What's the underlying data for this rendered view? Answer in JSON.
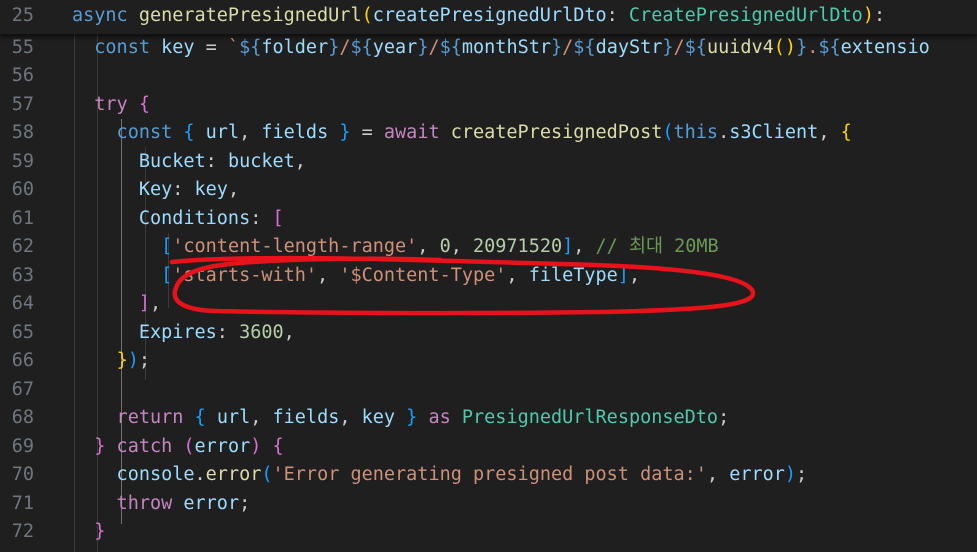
{
  "editor": {
    "sticky": {
      "line_number": "25",
      "tokens": [
        {
          "t": "async ",
          "c": "kw"
        },
        {
          "t": "generatePresignedUrl",
          "c": "fn"
        },
        {
          "t": "(",
          "c": "br1"
        },
        {
          "t": "createPresignedUrlDto",
          "c": "vr"
        },
        {
          "t": ": ",
          "c": "pn"
        },
        {
          "t": "CreatePresignedUrlDto",
          "c": "ty"
        },
        {
          "t": ")",
          "c": "br1"
        },
        {
          "t": ":",
          "c": "pn"
        }
      ]
    },
    "lines": [
      {
        "n": "55",
        "tokens": [
          {
            "t": "  const ",
            "c": "kw"
          },
          {
            "t": "key",
            "c": "vr"
          },
          {
            "t": " = ",
            "c": "pn"
          },
          {
            "t": "`",
            "c": "str"
          },
          {
            "t": "${",
            "c": "kw"
          },
          {
            "t": "folder",
            "c": "vr"
          },
          {
            "t": "}",
            "c": "kw"
          },
          {
            "t": "/",
            "c": "str"
          },
          {
            "t": "${",
            "c": "kw"
          },
          {
            "t": "year",
            "c": "vr"
          },
          {
            "t": "}",
            "c": "kw"
          },
          {
            "t": "/",
            "c": "str"
          },
          {
            "t": "${",
            "c": "kw"
          },
          {
            "t": "monthStr",
            "c": "vr"
          },
          {
            "t": "}",
            "c": "kw"
          },
          {
            "t": "/",
            "c": "str"
          },
          {
            "t": "${",
            "c": "kw"
          },
          {
            "t": "dayStr",
            "c": "vr"
          },
          {
            "t": "}",
            "c": "kw"
          },
          {
            "t": "/",
            "c": "str"
          },
          {
            "t": "${",
            "c": "kw"
          },
          {
            "t": "uuidv4",
            "c": "fn"
          },
          {
            "t": "()",
            "c": "br1"
          },
          {
            "t": "}",
            "c": "kw"
          },
          {
            "t": ".",
            "c": "str"
          },
          {
            "t": "${",
            "c": "kw"
          },
          {
            "t": "extensio",
            "c": "vr"
          }
        ]
      },
      {
        "n": "56",
        "tokens": []
      },
      {
        "n": "57",
        "tokens": [
          {
            "t": "  try ",
            "c": "ctl"
          },
          {
            "t": "{",
            "c": "br2"
          }
        ]
      },
      {
        "n": "58",
        "tokens": [
          {
            "t": "    const ",
            "c": "kw"
          },
          {
            "t": "{ ",
            "c": "br3"
          },
          {
            "t": "url",
            "c": "vr"
          },
          {
            "t": ", ",
            "c": "pn"
          },
          {
            "t": "fields",
            "c": "vr"
          },
          {
            "t": " }",
            "c": "br3"
          },
          {
            "t": " = ",
            "c": "pn"
          },
          {
            "t": "await ",
            "c": "ctl"
          },
          {
            "t": "createPresignedPost",
            "c": "fn"
          },
          {
            "t": "(",
            "c": "br3"
          },
          {
            "t": "this",
            "c": "kw"
          },
          {
            "t": ".",
            "c": "pn"
          },
          {
            "t": "s3Client",
            "c": "vr"
          },
          {
            "t": ", ",
            "c": "pn"
          },
          {
            "t": "{",
            "c": "br1"
          }
        ]
      },
      {
        "n": "59",
        "tokens": [
          {
            "t": "      Bucket",
            "c": "vr"
          },
          {
            "t": ": ",
            "c": "pn"
          },
          {
            "t": "bucket",
            "c": "vr"
          },
          {
            "t": ",",
            "c": "pn"
          }
        ]
      },
      {
        "n": "60",
        "tokens": [
          {
            "t": "      Key",
            "c": "vr"
          },
          {
            "t": ": ",
            "c": "pn"
          },
          {
            "t": "key",
            "c": "vr"
          },
          {
            "t": ",",
            "c": "pn"
          }
        ]
      },
      {
        "n": "61",
        "tokens": [
          {
            "t": "      Conditions",
            "c": "vr"
          },
          {
            "t": ": ",
            "c": "pn"
          },
          {
            "t": "[",
            "c": "br2"
          }
        ]
      },
      {
        "n": "62",
        "tokens": [
          {
            "t": "        ",
            "c": "pn"
          },
          {
            "t": "[",
            "c": "br3"
          },
          {
            "t": "'content-length-range'",
            "c": "str"
          },
          {
            "t": ", ",
            "c": "pn"
          },
          {
            "t": "0",
            "c": "num"
          },
          {
            "t": ", ",
            "c": "pn"
          },
          {
            "t": "20971520",
            "c": "num"
          },
          {
            "t": "]",
            "c": "br3"
          },
          {
            "t": ", ",
            "c": "pn"
          },
          {
            "t": "// 최대 20MB",
            "c": "cmt"
          }
        ]
      },
      {
        "n": "63",
        "tokens": [
          {
            "t": "        ",
            "c": "pn"
          },
          {
            "t": "[",
            "c": "br3"
          },
          {
            "t": "'starts-with'",
            "c": "str"
          },
          {
            "t": ", ",
            "c": "pn"
          },
          {
            "t": "'$Content-Type'",
            "c": "str"
          },
          {
            "t": ", ",
            "c": "pn"
          },
          {
            "t": "fileType",
            "c": "vr"
          },
          {
            "t": "]",
            "c": "br3"
          },
          {
            "t": ",",
            "c": "pn"
          }
        ]
      },
      {
        "n": "64",
        "tokens": [
          {
            "t": "      ",
            "c": "pn"
          },
          {
            "t": "]",
            "c": "br2"
          },
          {
            "t": ",",
            "c": "pn"
          }
        ]
      },
      {
        "n": "65",
        "tokens": [
          {
            "t": "      Expires",
            "c": "vr"
          },
          {
            "t": ": ",
            "c": "pn"
          },
          {
            "t": "3600",
            "c": "num"
          },
          {
            "t": ",",
            "c": "pn"
          }
        ]
      },
      {
        "n": "66",
        "tokens": [
          {
            "t": "    ",
            "c": "pn"
          },
          {
            "t": "}",
            "c": "br1"
          },
          {
            "t": ")",
            "c": "br3"
          },
          {
            "t": ";",
            "c": "pn"
          }
        ]
      },
      {
        "n": "67",
        "tokens": []
      },
      {
        "n": "68",
        "tokens": [
          {
            "t": "    return ",
            "c": "ctl"
          },
          {
            "t": "{ ",
            "c": "br3"
          },
          {
            "t": "url",
            "c": "vr"
          },
          {
            "t": ", ",
            "c": "pn"
          },
          {
            "t": "fields",
            "c": "vr"
          },
          {
            "t": ", ",
            "c": "pn"
          },
          {
            "t": "key",
            "c": "vr"
          },
          {
            "t": " }",
            "c": "br3"
          },
          {
            "t": " as ",
            "c": "ctl"
          },
          {
            "t": "PresignedUrlResponseDto",
            "c": "ty"
          },
          {
            "t": ";",
            "c": "pn"
          }
        ]
      },
      {
        "n": "69",
        "tokens": [
          {
            "t": "  ",
            "c": "pn"
          },
          {
            "t": "}",
            "c": "br2"
          },
          {
            "t": " catch ",
            "c": "ctl"
          },
          {
            "t": "(",
            "c": "br2"
          },
          {
            "t": "error",
            "c": "vr"
          },
          {
            "t": ")",
            "c": "br2"
          },
          {
            "t": " ",
            "c": "pn"
          },
          {
            "t": "{",
            "c": "br2"
          }
        ]
      },
      {
        "n": "70",
        "tokens": [
          {
            "t": "    console",
            "c": "vr"
          },
          {
            "t": ".",
            "c": "pn"
          },
          {
            "t": "error",
            "c": "fn"
          },
          {
            "t": "(",
            "c": "br3"
          },
          {
            "t": "'Error generating presigned post data:'",
            "c": "str"
          },
          {
            "t": ", ",
            "c": "pn"
          },
          {
            "t": "error",
            "c": "vr"
          },
          {
            "t": ")",
            "c": "br3"
          },
          {
            "t": ";",
            "c": "pn"
          }
        ]
      },
      {
        "n": "71",
        "tokens": [
          {
            "t": "    throw ",
            "c": "ctl"
          },
          {
            "t": "error",
            "c": "vr"
          },
          {
            "t": ";",
            "c": "pn"
          }
        ]
      },
      {
        "n": "72",
        "tokens": [
          {
            "t": "  ",
            "c": "pn"
          },
          {
            "t": "}",
            "c": "br2"
          }
        ]
      }
    ],
    "annotation": {
      "description_color": "#e8121b"
    }
  }
}
